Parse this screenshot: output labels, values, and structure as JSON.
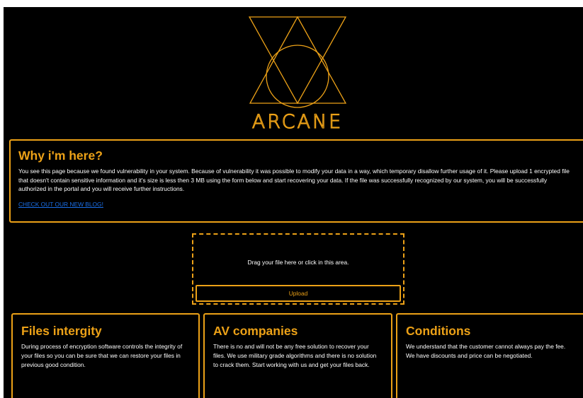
{
  "logo": {
    "text": "ARCANE",
    "icon": "arcane-triangles-circle-logo",
    "color": "#ECA117"
  },
  "why": {
    "title": "Why i'm here?",
    "body": "You see this page because we found vulnerability in your system. Because of vulnerability it was possible to modify your data in a way, which temporary disallow further usage of it. Please upload 1 encrypted file that doesn't contain sensitive information and it's size is less then 3 MB using the form below and start recovering your data. If the file was successfully recognized by our system, you will be successfully authorized in the portal and you will receive further instructions.",
    "link": "CHECK OUT OUR NEW BLOG!"
  },
  "upload": {
    "drop_text": "Drag your file here or click in this area.",
    "button_label": "Upload"
  },
  "cards": [
    {
      "title": "Files intergity",
      "body": "During process of encryption software controls the integrity of your files so you can be sure that we can restore your files in previous good condition."
    },
    {
      "title": "AV companies",
      "body": "There is no and will not be any free solution to recover your files. We use military grade algorithms and there is no solution to crack them. Start working with us and get your files back."
    },
    {
      "title": "Conditions",
      "body": "We understand that the customer cannot always pay the fee. We have discounts and price can be negotiated."
    }
  ],
  "colors": {
    "accent": "#ECA117",
    "background": "#000000",
    "link": "#1A6FE8"
  }
}
